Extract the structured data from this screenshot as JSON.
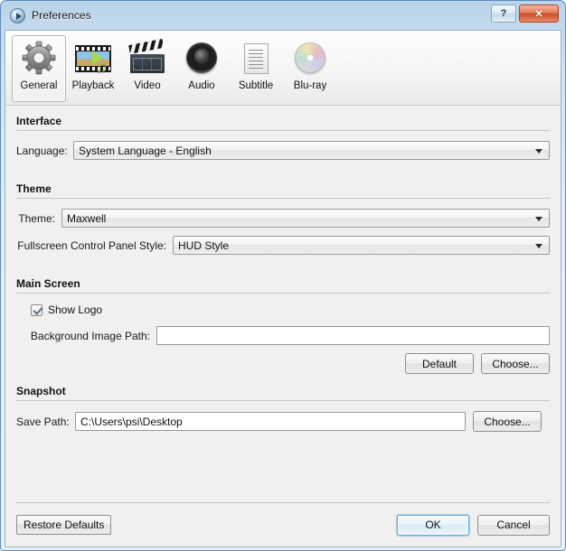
{
  "window": {
    "title": "Preferences",
    "title_icon": "media-play-circle-icon",
    "help_label": "?",
    "close_label": "✕"
  },
  "toolbar": {
    "items": [
      {
        "label": "General",
        "icon": "gear-icon",
        "selected": true
      },
      {
        "label": "Playback",
        "icon": "film-strip-icon",
        "selected": false
      },
      {
        "label": "Video",
        "icon": "clapperboard-icon",
        "selected": false
      },
      {
        "label": "Audio",
        "icon": "speaker-icon",
        "selected": false
      },
      {
        "label": "Subtitle",
        "icon": "document-icon",
        "selected": false
      },
      {
        "label": "Blu-ray",
        "icon": "disc-icon",
        "selected": false
      }
    ]
  },
  "sections": {
    "interface": {
      "title": "Interface",
      "language_label": "Language:",
      "language_value": "System Language - English"
    },
    "theme": {
      "title": "Theme",
      "theme_label": "Theme:",
      "theme_value": "Maxwell",
      "fullscreen_label": "Fullscreen Control Panel Style:",
      "fullscreen_value": "HUD Style"
    },
    "main_screen": {
      "title": "Main Screen",
      "show_logo_label": "Show Logo",
      "show_logo_checked": true,
      "bg_path_label": "Background Image Path:",
      "bg_path_value": "",
      "default_button": "Default",
      "choose_button": "Choose..."
    },
    "snapshot": {
      "title": "Snapshot",
      "save_path_label": "Save Path:",
      "save_path_value": "C:\\Users\\psi\\Desktop",
      "choose_button": "Choose..."
    }
  },
  "footer": {
    "restore_defaults": "Restore Defaults",
    "ok": "OK",
    "cancel": "Cancel"
  },
  "colors": {
    "titlebar_blue": "#b9d3ea",
    "close_red": "#cd4c28",
    "focus_blue": "#5ea8d8",
    "pane_gray": "#f0f0f0"
  }
}
